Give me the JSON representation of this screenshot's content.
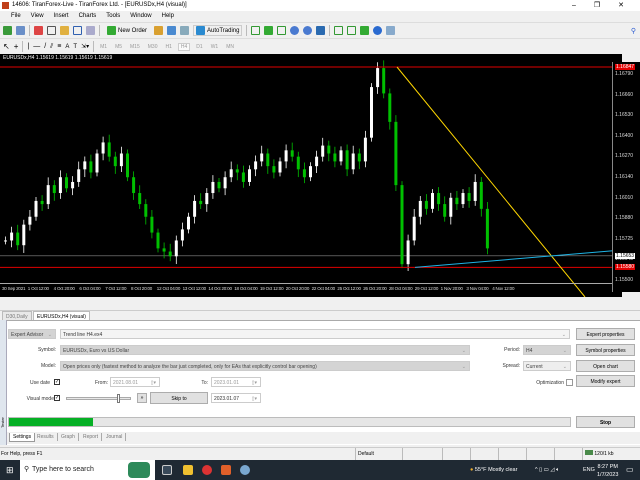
{
  "window": {
    "title": "14606: TiranForex-Live - TiranForex Ltd. - [EURUSDx,H4 (visual)]",
    "minimize": "–",
    "restore": "❐",
    "close": "✕"
  },
  "menu": [
    "File",
    "View",
    "Insert",
    "Charts",
    "Tools",
    "Window",
    "Help"
  ],
  "toolbar": {
    "new_order": "New Order",
    "autotrading": "AutoTrading",
    "timeframes": [
      "M1",
      "M5",
      "M15",
      "M30",
      "H1",
      "H4",
      "D1",
      "W1",
      "MN"
    ],
    "active_timeframe": "H4"
  },
  "chart": {
    "info": "EURUSDx,H4  1.15619 1.15619 1.15619 1.15619",
    "price_labels": [
      "1.16790",
      "1.16660",
      "1.16530",
      "1.16400",
      "1.16270",
      "1.16140",
      "1.16010",
      "1.15880",
      "1.15725",
      "1.15645",
      "1.15500"
    ],
    "red_label_top": "1.16847",
    "red_label_bottom": "1.15580",
    "current_label": "1.15653",
    "time_labels": [
      "30 Sep 2021",
      "1 Oct 12:00",
      "4 Oct 20:00",
      "6 Oct 04:00",
      "7 Oct 12:00",
      "8 Oct 20:00",
      "12 Oct 04:00",
      "13 Oct 12:00",
      "14 Oct 20:00",
      "18 Oct 04:00",
      "19 Oct 12:00",
      "20 Oct 20:00",
      "22 Oct 04:00",
      "25 Oct 12:00",
      "26 Oct 20:00",
      "28 Oct 04:00",
      "29 Oct 12:00",
      "1 Nov 20:00",
      "3 Nov 04:00",
      "4 Nov 12:00"
    ],
    "closes": [
      1.1575,
      1.158,
      1.1572,
      1.1585,
      1.159,
      1.16,
      1.1598,
      1.161,
      1.1605,
      1.1615,
      1.1608,
      1.1612,
      1.162,
      1.1625,
      1.1618,
      1.163,
      1.1637,
      1.1628,
      1.1622,
      1.163,
      1.1615,
      1.1605,
      1.1598,
      1.159,
      1.158,
      1.157,
      1.1568,
      1.1565,
      1.1575,
      1.1582,
      1.159,
      1.16,
      1.1598,
      1.1605,
      1.1612,
      1.1608,
      1.1615,
      1.162,
      1.1618,
      1.1612,
      1.162,
      1.1625,
      1.163,
      1.1622,
      1.1618,
      1.1625,
      1.1632,
      1.1628,
      1.162,
      1.1615,
      1.1622,
      1.1628,
      1.1635,
      1.163,
      1.1625,
      1.1632,
      1.162,
      1.163,
      1.1625,
      1.164,
      1.1672,
      1.1684,
      1.1668,
      1.165,
      1.161,
      1.156,
      1.1575,
      1.159,
      1.16,
      1.1595,
      1.1605,
      1.1598,
      1.159,
      1.1602,
      1.1598,
      1.1605,
      1.16,
      1.1612,
      1.1595,
      1.157
    ],
    "colors": {
      "bull": "#ffffff",
      "bear": "#00c000",
      "support": "#e00000",
      "trend_down": "#ffd700",
      "trend_up": "#1eb4e6",
      "current": "#8a8a8a"
    },
    "tabs": [
      "D30,Daily",
      "EURUSDx,H4 (visual)"
    ]
  },
  "tester": {
    "sidebar_label": "Tester",
    "type": "Expert Advisor",
    "expert": "Trend line H4.ex4",
    "symbol_label": "Symbol:",
    "symbol": "EURUSDx, Euro vs US Dollar",
    "model_label": "Model:",
    "model": "Open prices only (fastest method to analyze the bar just completed, only for EAs that explicitly control bar opening)",
    "use_date_label": "Use date",
    "from_label": "From:",
    "from": "2021.08.01",
    "to_label": "To:",
    "to": "2023.01.01",
    "visual_label": "Visual mode",
    "skip_label": "Skip to",
    "skip_date": "2023.01.07",
    "ff": "»",
    "period_label": "Period:",
    "period": "H4",
    "spread_label": "Spread:",
    "spread": "Current",
    "optimization_label": "Optimization",
    "buttons": {
      "expert_properties": "Expert properties",
      "symbol_properties": "Symbol properties",
      "open_chart": "Open chart",
      "modify_expert": "Modify expert",
      "stop": "Stop"
    },
    "progress": 0.15,
    "tabs": [
      "Settings",
      "Results",
      "Graph",
      "Report",
      "Journal"
    ]
  },
  "status": {
    "help": "For Help, press F1",
    "profile": "Default",
    "traffic": "120/1 kb"
  },
  "taskbar": {
    "search": "Type here to search",
    "weather": "55°F  Mostly clear",
    "lang": "ENG",
    "time": "8:27 PM",
    "date": "1/7/2023"
  }
}
